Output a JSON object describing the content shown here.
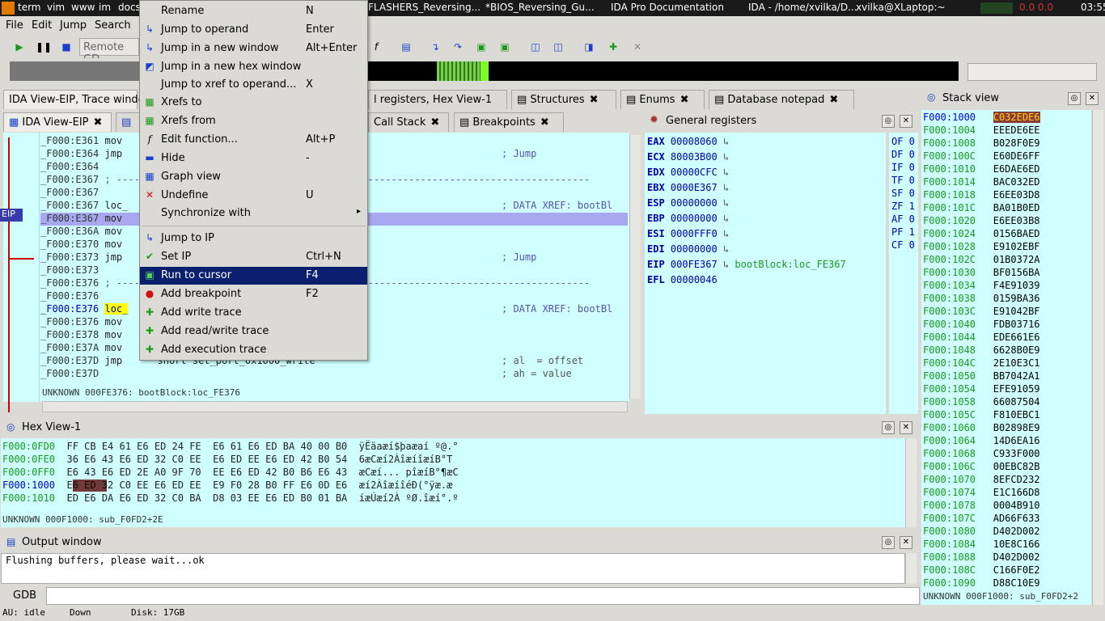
{
  "taskbar": {
    "items": [
      "term",
      "vim",
      "www",
      "im",
      "docs"
    ],
    "windows": [
      "FLASHERS_Reversing...",
      "*BIOS_Reversing_Gu...",
      "IDA Pro Documentation",
      "IDA - /home/xvilka/D...",
      "xvilka@XLaptop:~"
    ],
    "cpu": "0.0 0.0",
    "clock": "03:55"
  },
  "menubar": {
    "items": [
      "File",
      "Edit",
      "Jump",
      "Search"
    ]
  },
  "toolbar": {
    "debugger": "Remote GD"
  },
  "tabs_top": [
    "IDA View-EIP, Trace window",
    "l registers, Hex View-1",
    "Structures",
    "Enums",
    "Database notepad"
  ],
  "tabs_sub": [
    "IDA View-EIP",
    "Call Stack",
    "Breakpoints"
  ],
  "eip_label": "EIP",
  "code_lines": [
    {
      "a": "_F000:E361",
      "t": "mov",
      "c": ""
    },
    {
      "a": "_F000:E364",
      "t": "jmp",
      "c": "; Jump"
    },
    {
      "a": "_F000:E364",
      "t": "",
      "c": ""
    },
    {
      "a": "_F000:E367",
      "t": "; ---------------------------------------------------------------------------------",
      "c": ""
    },
    {
      "a": "_F000:E367",
      "t": "",
      "c": ""
    },
    {
      "a": "_F000:E367",
      "t": "loc_",
      "c": "; DATA XREF: bootBl"
    },
    {
      "a": "_F000:E367",
      "t": "mov",
      "c": ""
    },
    {
      "a": "_F000:E36A",
      "t": "mov",
      "c": ""
    },
    {
      "a": "_F000:E370",
      "t": "mov",
      "c": ""
    },
    {
      "a": "_F000:E373",
      "t": "jmp",
      "c": "; Jump"
    },
    {
      "a": "_F000:E373",
      "t": "",
      "c": ""
    },
    {
      "a": "_F000:E376",
      "t": "; ---------------------------------------------------------------------------------",
      "c": ""
    },
    {
      "a": "_F000:E376",
      "t": "",
      "c": ""
    },
    {
      "a": "_F000:E376",
      "t": "loc_",
      "c": "; DATA XREF: bootBl"
    },
    {
      "a": "_F000:E376",
      "t": "mov",
      "c": ""
    },
    {
      "a": "_F000:E378",
      "t": "mov",
      "c": ""
    },
    {
      "a": "_F000:E37A",
      "t": "mov",
      "c": ""
    },
    {
      "a": "_F000:E37D",
      "t": "jmp      short set_port_0x1000_write",
      "c": "; al  = offset"
    },
    {
      "a": "_F000:E37D",
      "t": "",
      "c": "; ah = value"
    }
  ],
  "code_status": "UNKNOWN 000FE376: bootBlock:loc_FE376",
  "context_menu": [
    {
      "label": "Rename",
      "shortcut": "N",
      "icon": "rename-icon"
    },
    {
      "label": "Jump to operand",
      "shortcut": "Enter",
      "icon": "jump-icon"
    },
    {
      "label": "Jump in a new window",
      "shortcut": "Alt+Enter",
      "icon": "jump-window-icon"
    },
    {
      "label": "Jump in a new hex window",
      "shortcut": "",
      "icon": "hex-window-icon"
    },
    {
      "label": "Jump to xref to operand...",
      "shortcut": "X",
      "icon": ""
    },
    {
      "label": "Xrefs to",
      "shortcut": "",
      "icon": "xrefs-to-icon"
    },
    {
      "label": "Xrefs from",
      "shortcut": "",
      "icon": "xrefs-from-icon"
    },
    {
      "label": "Edit function...",
      "shortcut": "Alt+P",
      "icon": "function-icon"
    },
    {
      "label": "Hide",
      "shortcut": "-",
      "icon": "hide-icon"
    },
    {
      "label": "Graph view",
      "shortcut": "",
      "icon": "graph-icon"
    },
    {
      "label": "Undefine",
      "shortcut": "U",
      "icon": "undefine-icon"
    },
    {
      "label": "Synchronize with",
      "shortcut": "",
      "icon": ""
    },
    {
      "label": "Jump to IP",
      "shortcut": "",
      "icon": "jump-ip-icon"
    },
    {
      "label": "Set IP",
      "shortcut": "Ctrl+N",
      "icon": "set-ip-icon"
    },
    {
      "label": "Run to cursor",
      "shortcut": "F4",
      "icon": "run-cursor-icon"
    },
    {
      "label": "Add breakpoint",
      "shortcut": "F2",
      "icon": "breakpoint-icon"
    },
    {
      "label": "Add write trace",
      "shortcut": "",
      "icon": "write-trace-icon"
    },
    {
      "label": "Add read/write trace",
      "shortcut": "",
      "icon": "rw-trace-icon"
    },
    {
      "label": "Add execution trace",
      "shortcut": "",
      "icon": "exec-trace-icon"
    }
  ],
  "registers_title": "General registers",
  "registers": [
    {
      "n": "EAX",
      "v": "00008060",
      "x": ""
    },
    {
      "n": "ECX",
      "v": "80003B00",
      "x": ""
    },
    {
      "n": "EDX",
      "v": "00000CFC",
      "x": ""
    },
    {
      "n": "EBX",
      "v": "0000E367",
      "x": ""
    },
    {
      "n": "ESP",
      "v": "00000000",
      "x": ""
    },
    {
      "n": "EBP",
      "v": "00000000",
      "x": ""
    },
    {
      "n": "ESI",
      "v": "0000FFF0",
      "x": ""
    },
    {
      "n": "EDI",
      "v": "00000000",
      "x": ""
    },
    {
      "n": "EIP",
      "v": "000FE367",
      "x": "bootBlock:loc_FE367"
    },
    {
      "n": "EFL",
      "v": "00000046",
      "x": ""
    }
  ],
  "flags": [
    "OF 0",
    "DF 0",
    "IF 0",
    "TF 0",
    "SF 0",
    "ZF 1",
    "AF 0",
    "PF 1",
    "CF 0"
  ],
  "stack_title": "Stack view",
  "stack": [
    [
      "F000:1000",
      "C032EDE6"
    ],
    [
      "F000:1004",
      "EEEDE6EE"
    ],
    [
      "F000:1008",
      "B028F0E9"
    ],
    [
      "F000:100C",
      "E60DE6FF"
    ],
    [
      "F000:1010",
      "E6DAE6ED"
    ],
    [
      "F000:1014",
      "BAC032ED"
    ],
    [
      "F000:1018",
      "E6EE03D8"
    ],
    [
      "F000:101C",
      "BA01B0ED"
    ],
    [
      "F000:1020",
      "E6EE03B8"
    ],
    [
      "F000:1024",
      "0156BAED"
    ],
    [
      "F000:1028",
      "E9102EBF"
    ],
    [
      "F000:102C",
      "01B0372A"
    ],
    [
      "F000:1030",
      "BF0156BA"
    ],
    [
      "F000:1034",
      "F4E91039"
    ],
    [
      "F000:1038",
      "0159BA36"
    ],
    [
      "F000:103C",
      "E91042BF"
    ],
    [
      "F000:1040",
      "FDB03716"
    ],
    [
      "F000:1044",
      "EDE661E6"
    ],
    [
      "F000:1048",
      "6628B0E9"
    ],
    [
      "F000:104C",
      "2E10E3C1"
    ],
    [
      "F000:1050",
      "BB7042A1"
    ],
    [
      "F000:1054",
      "EFE91059"
    ],
    [
      "F000:1058",
      "66087504"
    ],
    [
      "F000:105C",
      "F810EBC1"
    ],
    [
      "F000:1060",
      "B02898E9"
    ],
    [
      "F000:1064",
      "14D6EA16"
    ],
    [
      "F000:1068",
      "C933F000"
    ],
    [
      "F000:106C",
      "00EBC82B"
    ],
    [
      "F000:1070",
      "8EFCD232"
    ],
    [
      "F000:1074",
      "E1C166D8"
    ],
    [
      "F000:1078",
      "0004B910"
    ],
    [
      "F000:107C",
      "AD66F633"
    ],
    [
      "F000:1080",
      "D402D002"
    ],
    [
      "F000:1084",
      "10E8C166"
    ],
    [
      "F000:1088",
      "D402D002"
    ],
    [
      "F000:108C",
      "C166F0E2"
    ],
    [
      "F000:1090",
      "D88C10E9"
    ]
  ],
  "stack_status": "UNKNOWN 000F1000: sub_F0FD2+2",
  "hex_title": "Hex View-1",
  "hex_lines": [
    {
      "a": "F000:0FD0",
      "h": "FF CB E4 61 E6 ED 24 FE  E6 61 E6 ED BA 40 00 B0",
      "s": "ÿËäaæí$þaæaí º@.°"
    },
    {
      "a": "F000:0FE0",
      "h": "36 E6 43 E6 ED 32 C0 EE  E6 ED EE E6 ED 42 B0 54",
      "s": "6æCæí2ÀîæíîæíB°T"
    },
    {
      "a": "F000:0FF0",
      "h": "E6 43 E6 ED 2E A0 9F 70  EE E6 ED 42 B0 B6 E6 43",
      "s": "æCæí... pîæíB°¶æC"
    },
    {
      "a": "F000:1000",
      "h": "E6 ED 32 C0 EE E6 ED EE  E9 F0 28 B0 FF E6 0D E6",
      "s": "æí2ÀîæíîéÐ(°ÿæ.æ"
    },
    {
      "a": "F000:1010",
      "h": "ED E6 DA E6 ED 32 C0 BA  D8 03 EE E6 ED B0 01 BA",
      "s": "íæÚæí2À ºØ.îæí°.º"
    }
  ],
  "hex_status": "UNKNOWN 000F1000: sub_F0FD2+2E",
  "output_title": "Output window",
  "output_text": "Flushing buffers, please wait...ok",
  "gdb_label": "GDB",
  "statusbar": {
    "au": "AU:  idle",
    "dir": "Down",
    "disk": "Disk: 17GB"
  }
}
